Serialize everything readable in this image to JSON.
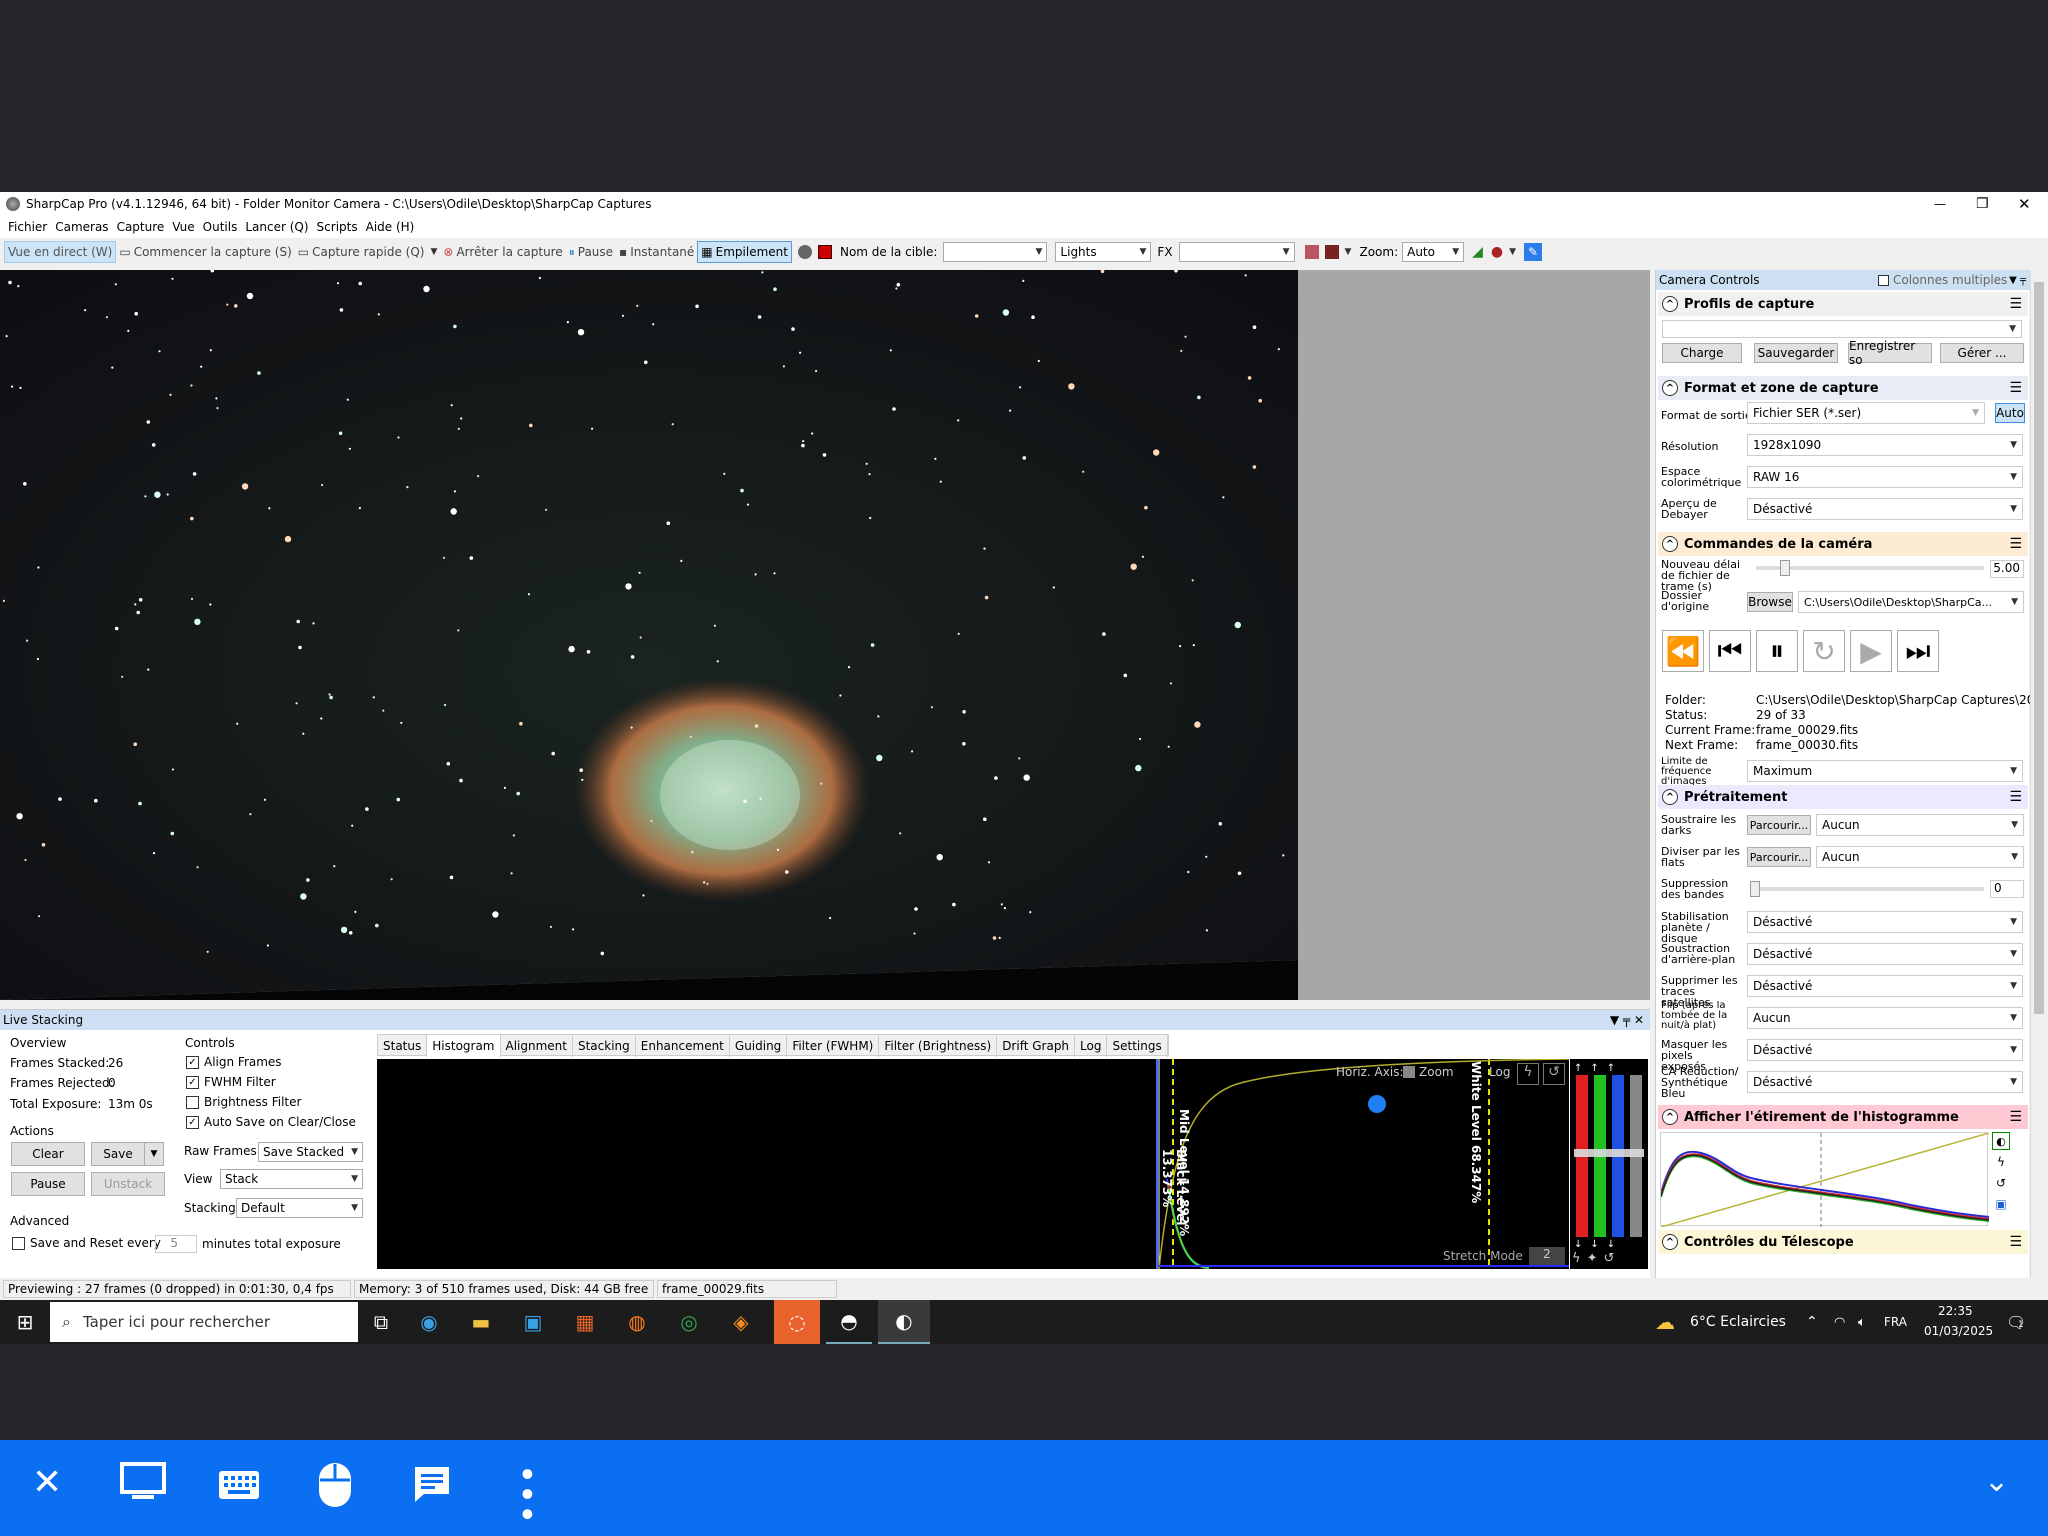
{
  "window": {
    "title": "SharpCap Pro (v4.1.12946, 64 bit) - Folder Monitor Camera - C:\\Users\\Odile\\Desktop\\SharpCap Captures",
    "minimize": "—",
    "maximize": "❐",
    "close": "✕"
  },
  "menu": [
    "Fichier",
    "Cameras",
    "Capture",
    "Vue",
    "Outils",
    "Lancer (Q)",
    "Scripts",
    "Aide (H)"
  ],
  "toolbar": {
    "live_view": "Vue en direct (W)",
    "start_capture": "Commencer la capture (S)",
    "quick_capture": "Capture rapide (Q)",
    "stop_capture": "Arrêter la capture",
    "pause": "Pause",
    "snapshot": "Instantané",
    "stacking": "Empilement",
    "target_label": "Nom de la cible:",
    "target_value": "",
    "frame_type": "Lights",
    "fx_label": "FX",
    "fx_value": "",
    "zoom_label": "Zoom:",
    "zoom_value": "Auto"
  },
  "camera_controls": {
    "header": "Camera Controls",
    "multi_columns": "Colonnes multiples",
    "profiles": {
      "title": "Profils de capture",
      "selected": "",
      "load": "Charge",
      "save": "Sauvegarder",
      "save_as": "Enregistrer so",
      "manage": "Gérer ..."
    },
    "format": {
      "title": "Format et zone de capture",
      "output_label": "Format de sortie",
      "output_value": "Fichier SER (*.ser)",
      "auto": "Auto",
      "resolution_label": "Résolution",
      "resolution_value": "1928x1090",
      "colorspace_label": "Espace colorimétrique",
      "colorspace_value": "RAW 16",
      "debayer_label": "Aperçu de Debayer",
      "debayer_value": "Désactivé"
    },
    "camera": {
      "title": "Commandes de la caméra",
      "delay_label": "Nouveau délai de fichier de trame (s)",
      "delay_value": "5.00",
      "source_label": "Dossier d'origine",
      "browse": "Browse",
      "source_value": "C:\\Users\\Odile\\Desktop\\SharpCa...",
      "folder_label": "Folder:",
      "folder_value": "C:\\Users\\Odile\\Desktop\\SharpCap Captures\\20",
      "status_label": "Status:",
      "status_value": "29 of 33",
      "current_label": "Current Frame:",
      "current_value": "frame_00029.fits",
      "next_label": "Next Frame:",
      "next_value": "frame_00030.fits",
      "framerate_label": "Limite de fréquence d'images",
      "framerate_value": "Maximum"
    },
    "preprocessing": {
      "title": "Prétraitement",
      "darks_label": "Soustraire les darks",
      "darks_btn": "Parcourir...",
      "darks_value": "Aucun",
      "flats_label": "Diviser par les flats",
      "flats_btn": "Parcourir...",
      "flats_value": "Aucun",
      "banding_label": "Suppression des bandes",
      "banding_value": "0",
      "stab_label": "Stabilisation planète / disque",
      "stab_value": "Désactivé",
      "bg_label": "Soustraction d'arrière-plan",
      "bg_value": "Désactivé",
      "sat_label": "Supprimer les traces satellites",
      "sat_value": "Désactivé",
      "flip_label": "Flip (après la tombée de la nuit/à plat)",
      "flip_value": "Aucun",
      "hot_label": "Masquer les pixels exposés",
      "hot_value": "Désactivé",
      "ca_label": "CA Réduction/ Synthétique Bleu",
      "ca_value": "Désactivé"
    },
    "stretch_title": "Afficher l'étirement de l'histogramme",
    "telescope_title": "Contrôles du Télescope"
  },
  "live_stacking": {
    "title": "Live Stacking",
    "overview": "Overview",
    "frames_stacked_label": "Frames Stacked:",
    "frames_stacked": "26",
    "frames_rejected_label": "Frames Rejected:",
    "frames_rejected": "0",
    "exposure_label": "Total Exposure:",
    "exposure": "13m 0s",
    "actions": "Actions",
    "clear": "Clear",
    "save": "Save",
    "pause": "Pause",
    "unstack": "Unstack",
    "advanced": "Advanced",
    "save_reset": "Save and Reset every",
    "save_reset_value": "5",
    "save_reset_unit": "minutes total exposure",
    "controls": "Controls",
    "align_frames": "Align Frames",
    "fwhm_filter": "FWHM Filter",
    "brightness_filter": "Brightness Filter",
    "auto_save": "Auto Save on Clear/Close",
    "raw_frames_label": "Raw Frames",
    "raw_frames_value": "Save Stacked",
    "view_label": "View",
    "view_value": "Stack",
    "stacking_label": "Stacking",
    "stacking_value": "Default",
    "tabs": [
      "Status",
      "Histogram",
      "Alignment",
      "Stacking",
      "Enhancement",
      "Guiding",
      "Filter (FWHM)",
      "Filter (Brightness)",
      "Drift Graph",
      "Log",
      "Settings"
    ],
    "horiz_axis": "Horiz. Axis:",
    "zoom": "Zoom",
    "log": "Log",
    "mid_level": "Mid Level 14.892%",
    "black_level": "Black Level 13.373%",
    "white_level": "White Level 68.347%",
    "stretch_mode": "Stretch Mode",
    "stretch_mode_value": "2"
  },
  "statusbar": {
    "preview": "Previewing : 27 frames (0 dropped) in 0:01:30, 0,4 fps",
    "memory": "Memory: 3 of 510 frames used, Disk: 44 GB free",
    "file": "frame_00029.fits"
  },
  "taskbar": {
    "search_placeholder": "Taper ici pour rechercher",
    "weather": "6°C  Eclaircies",
    "lang": "FRA",
    "time": "22:35",
    "date": "01/03/2025",
    "notif_count": "1"
  },
  "colors": {
    "accent": "#0a6ff0",
    "stretch_header": "#ffc9d4",
    "camera_header": "#fdebd3",
    "preproc_header": "#ece9ff"
  }
}
